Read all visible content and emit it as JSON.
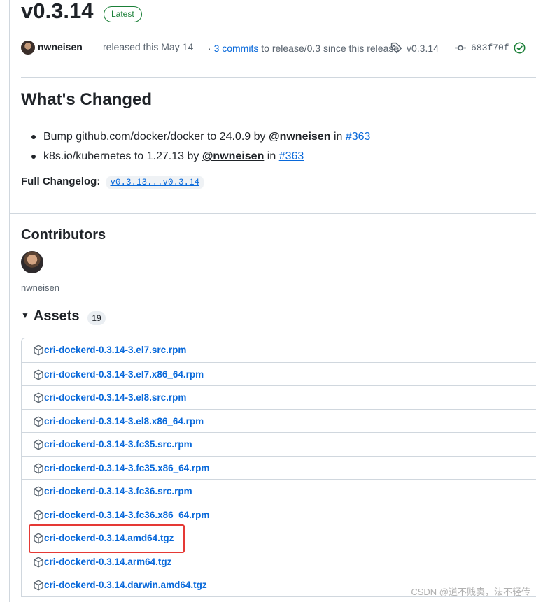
{
  "release": {
    "title": "v0.3.14",
    "badge": "Latest",
    "author": "nwneisen",
    "released_text": "released this May 14",
    "commits_prefix": "·",
    "commits_link": "3 commits",
    "commits_suffix": "to release/0.3 since this release",
    "tag": "v0.3.14",
    "commit_sha": "683f70f"
  },
  "changes": {
    "heading": "What's Changed",
    "items": [
      {
        "text": "Bump github.com/docker/docker to 24.0.9 by",
        "mention": "@nwneisen",
        "in": "in",
        "pr": "#363"
      },
      {
        "text": "k8s.io/kubernetes to 1.27.13 by",
        "mention": "@nwneisen",
        "in": "in",
        "pr": "#363"
      }
    ],
    "full_changelog_label": "Full Changelog:",
    "full_changelog_link": "v0.3.13...v0.3.14"
  },
  "contributors": {
    "heading": "Contributors",
    "names": [
      "nwneisen"
    ]
  },
  "assets": {
    "heading": "Assets",
    "count": "19",
    "files": [
      "cri-dockerd-0.3.14-3.el7.src.rpm",
      "cri-dockerd-0.3.14-3.el7.x86_64.rpm",
      "cri-dockerd-0.3.14-3.el8.src.rpm",
      "cri-dockerd-0.3.14-3.el8.x86_64.rpm",
      "cri-dockerd-0.3.14-3.fc35.src.rpm",
      "cri-dockerd-0.3.14-3.fc35.x86_64.rpm",
      "cri-dockerd-0.3.14-3.fc36.src.rpm",
      "cri-dockerd-0.3.14-3.fc36.x86_64.rpm",
      "cri-dockerd-0.3.14.amd64.tgz",
      "cri-dockerd-0.3.14.arm64.tgz",
      "cri-dockerd-0.3.14.darwin.amd64.tgz"
    ]
  },
  "watermark": "CSDN @道不贱卖，法不轻传",
  "colors": {
    "link": "#0969da",
    "latest": "#1a7f37",
    "highlight": "#e53935"
  }
}
